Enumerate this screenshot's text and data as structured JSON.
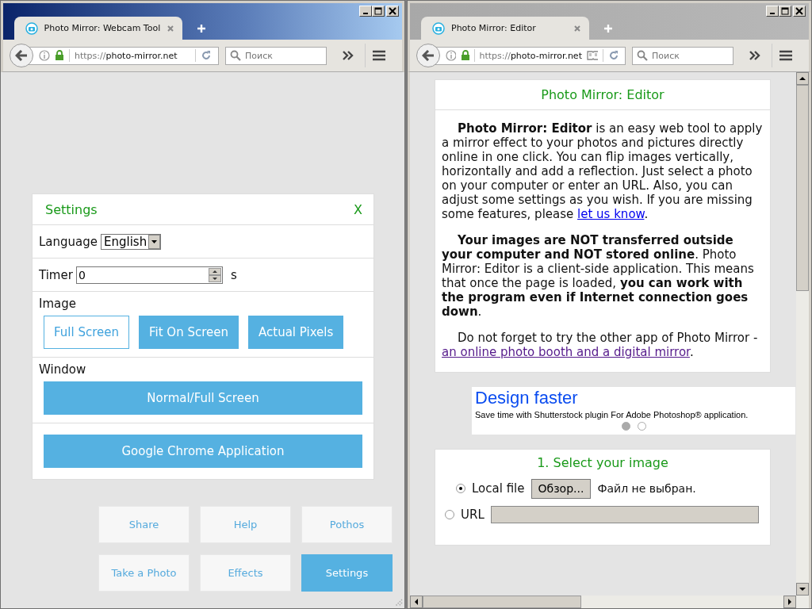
{
  "left_window": {
    "active": true,
    "tab_title": "Photo Mirror: Webcam Tool",
    "url": {
      "scheme": "https://",
      "host": "photo-mirror.net"
    },
    "reader_view": false,
    "search": {
      "placeholder": "Поиск"
    },
    "settings": {
      "title": "Settings",
      "close": "X",
      "language": {
        "label": "Language",
        "value": "English"
      },
      "timer": {
        "label": "Timer",
        "value": "0",
        "unit": "s"
      },
      "image": {
        "label": "Image",
        "options": [
          {
            "label": "Full Screen",
            "selected": true
          },
          {
            "label": "Fit On Screen",
            "selected": false
          },
          {
            "label": "Actual Pixels",
            "selected": false
          }
        ]
      },
      "window": {
        "label": "Window",
        "button": "Normal/Full Screen"
      },
      "app_button": "Google Chrome Application"
    },
    "app_buttons": [
      {
        "label": "Share",
        "selected": false
      },
      {
        "label": "Help",
        "selected": false
      },
      {
        "label": "Pothos",
        "selected": false
      },
      {
        "label": "Take a Photo",
        "selected": false
      },
      {
        "label": "Effects",
        "selected": false
      },
      {
        "label": "Settings",
        "selected": true
      }
    ]
  },
  "right_window": {
    "active": false,
    "tab_title": "Photo Mirror: Editor",
    "url": {
      "scheme": "https://",
      "host": "photo-mirror.net"
    },
    "reader_view": true,
    "search": {
      "placeholder": "Поиск"
    },
    "intro": {
      "title": "Photo Mirror: Editor",
      "paragraphs": [
        {
          "text": "**Photo Mirror: Editor** is an easy web tool to apply a mirror effect to your photos and pictures directly online in one click. You can flip images vertically, horizontally and add a reflection. Just select a photo on your computer or enter an URL. Also, you can adjust some settings as you wish. If you are missing some features, please",
          "link": "let us know",
          "link_visited": false,
          "after": "."
        },
        {
          "text": "**Your images are NOT transferred outside your computer and NOT stored online**. Photo Mirror: Editor is a client-side application. This means that once the page is loaded, **you can work with the program even if Internet connection goes down**."
        },
        {
          "text": "Do not forget to try the other app of Photo Mirror -",
          "link": "an online photo booth and a digital mirror",
          "link_visited": true,
          "after": "."
        }
      ]
    },
    "ad": {
      "headline": "Design faster",
      "text": "Save time with Shutterstock plugin For Adobe Photoshop® application.",
      "dots": [
        {
          "selected": true
        },
        {
          "selected": false
        }
      ]
    },
    "select": {
      "title": "1. Select your image",
      "options": [
        {
          "kind": "file",
          "label": "Local file",
          "selected": true,
          "button": "Обзор...",
          "status": "Файл не выбран."
        },
        {
          "kind": "url",
          "label": "URL",
          "selected": false
        }
      ]
    }
  }
}
